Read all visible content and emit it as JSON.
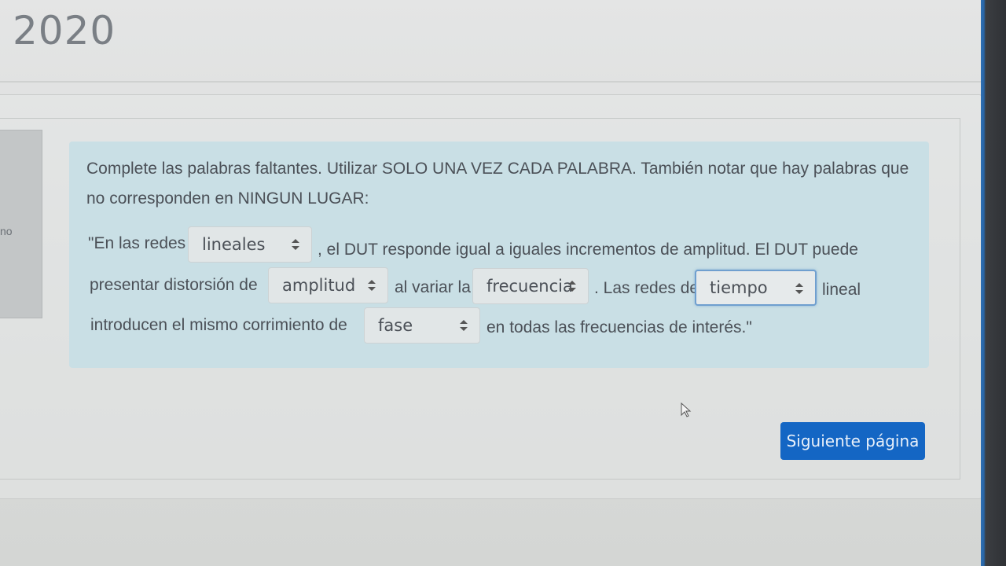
{
  "header": {
    "title": "2020"
  },
  "question_info": {
    "partial_text": "no"
  },
  "question": {
    "instructions": "Complete las palabras faltantes. Utilizar SOLO UNA VEZ CADA PALABRA. También notar que hay palabras que no corresponden en NINGUN LUGAR:",
    "line1": {
      "before": "\"En las redes",
      "after": ", el DUT responde igual a iguales incrementos de amplitud. El DUT puede"
    },
    "line2": {
      "before": "presentar distorsión de",
      "middle1": "al variar la",
      "middle2": ". Las redes de",
      "after": "lineal"
    },
    "line3": {
      "before": "introducen el mismo corrimiento de",
      "after": "en todas las frecuencias de interés.\""
    },
    "selects": {
      "s1": "lineales",
      "s2": "amplitud",
      "s3": "frecuencia",
      "s4": "tiempo",
      "s5": "fase"
    }
  },
  "navigation": {
    "next_label": "Siguiente página"
  },
  "colors": {
    "formulation_bg": "#c9dfe5",
    "primary_button": "#1466c4",
    "focus_ring": "#6f9fcf"
  }
}
